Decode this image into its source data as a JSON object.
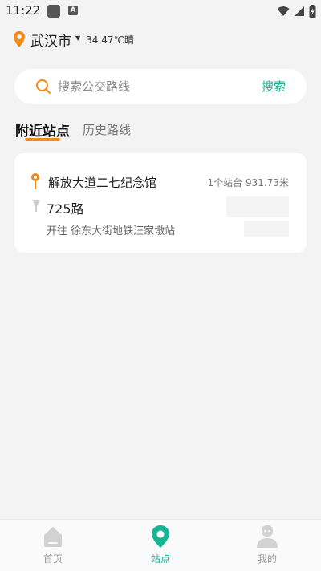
{
  "status_bar": {
    "time": "11:22",
    "a_badge": "A"
  },
  "location": {
    "city": "武汉市",
    "caret": "▼",
    "weather": "34.47℃晴"
  },
  "search": {
    "placeholder": "搜索公交路线",
    "button_label": "搜索"
  },
  "tabs": [
    {
      "label": "附近站点",
      "active": true
    },
    {
      "label": "历史路线",
      "active": false
    }
  ],
  "station": {
    "name": "解放大道二七纪念馆",
    "meta": "1个站台 931.73米",
    "route_number": "725路",
    "direction": "开往 徐东大街地铁汪家墩站"
  },
  "bottom_nav": [
    {
      "label": "首页",
      "icon": "home-icon",
      "active": false
    },
    {
      "label": "站点",
      "icon": "location-pin-icon",
      "active": true
    },
    {
      "label": "我的",
      "icon": "profile-icon",
      "active": false
    }
  ],
  "colors": {
    "accent": "#16b596",
    "orange": "#f08a18",
    "background": "#f2f3f2"
  }
}
